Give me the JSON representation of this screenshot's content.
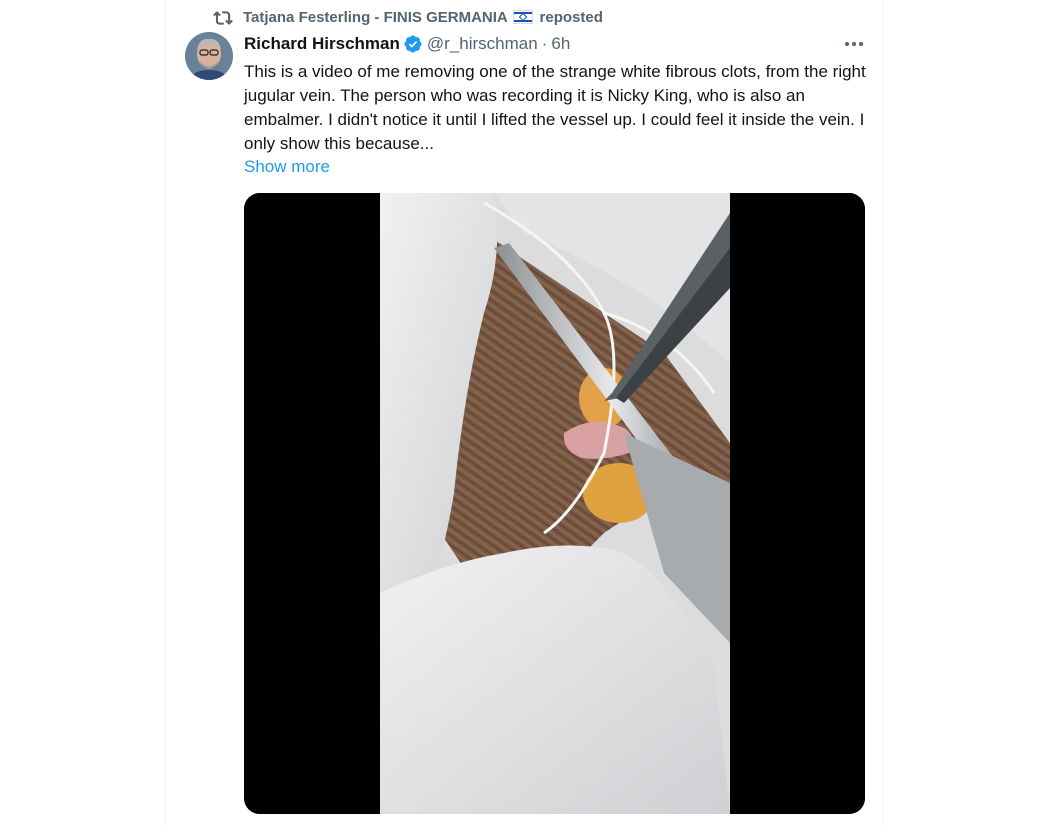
{
  "repost": {
    "reposter_name": "Tatjana Festerling - FINIS GERMANIA",
    "action": "reposted",
    "icon": "repost-icon",
    "flag": "israel-flag"
  },
  "post": {
    "author_name": "Richard Hirschman",
    "verified": true,
    "verified_color": "#1d9bf0",
    "handle": "@r_hirschman",
    "separator": "·",
    "time": "6h",
    "text": "This is a video of me removing one of the strange white fibrous clots, from the right jugular vein. The person who was recording it is Nicky King, who is also an embalmer. I  didn't notice it until I lifted the vessel up. I could feel it inside the vein. I only show this because...",
    "show_more_label": "Show more",
    "show_more_color": "#1d9bf0",
    "media_type": "video"
  },
  "colors": {
    "text_primary": "#0f1419",
    "text_secondary": "#536471",
    "link": "#1d9bf0"
  }
}
